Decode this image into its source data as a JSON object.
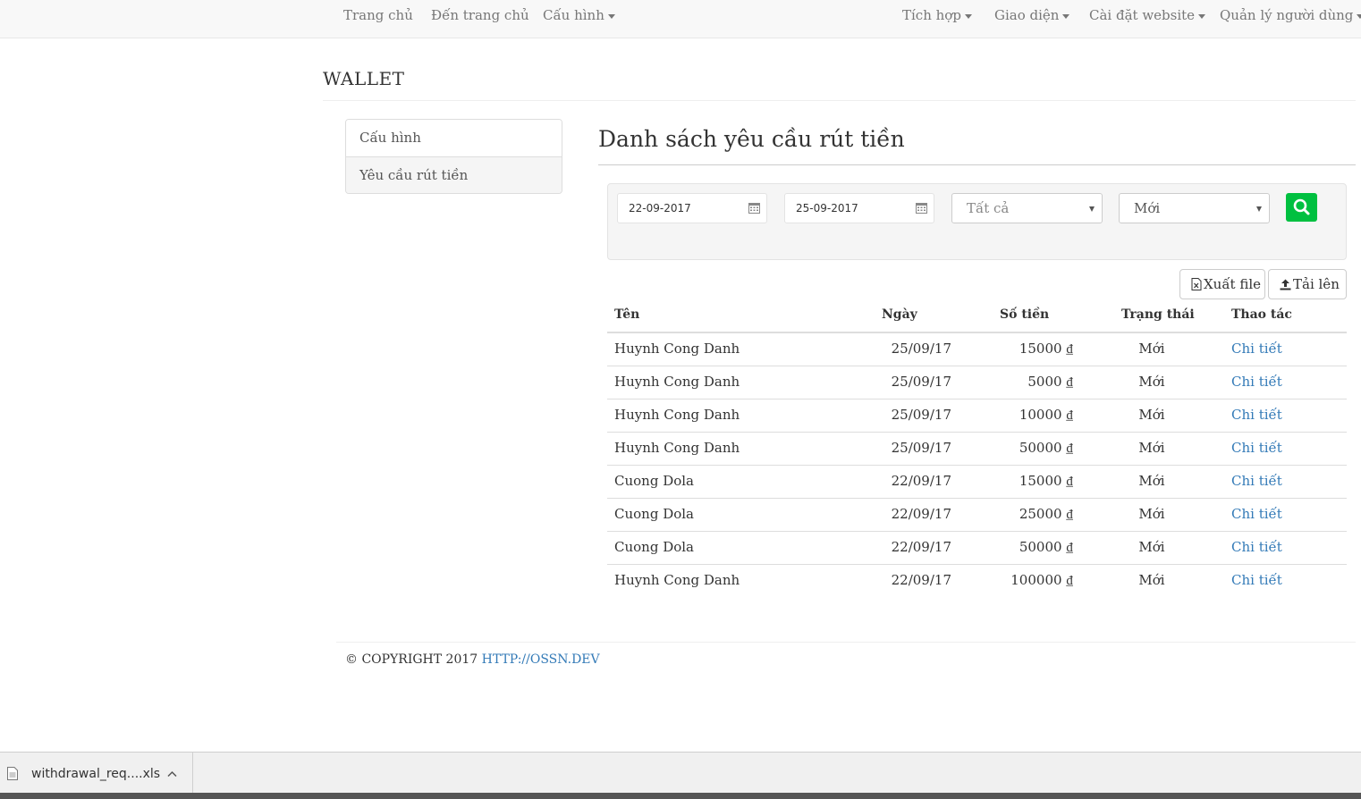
{
  "navbar": {
    "items": [
      {
        "label": "Trang chủ",
        "dropdown": false
      },
      {
        "label": "Đến trang chủ",
        "dropdown": false
      },
      {
        "label": "Cấu hình",
        "dropdown": true
      }
    ],
    "right_items": [
      {
        "label": "Tích hợp",
        "dropdown": true
      },
      {
        "label": "Giao diện",
        "dropdown": true
      },
      {
        "label": "Cài đặt website",
        "dropdown": true
      },
      {
        "label": "Quản lý người dùng",
        "dropdown": true
      }
    ]
  },
  "admin_title": "WALLET",
  "sidebar": {
    "items": [
      {
        "label": "Cấu hình",
        "active": false
      },
      {
        "label": "Yêu cầu rút tiền",
        "active": true
      }
    ]
  },
  "page_heading": "Danh sách yêu cầu rút tiền",
  "filters": {
    "from_date": "22-09-2017",
    "to_date": "25-09-2017",
    "type_select": "Tất cả",
    "status_select": "Mới",
    "search_icon": "search-icon",
    "calendar_icon": "calendar-icon"
  },
  "actions": {
    "export_label": "Xuất file",
    "upload_label": "Tải lên"
  },
  "table": {
    "headers": [
      "Tên",
      "Ngày",
      "Số tiền",
      "Trạng thái",
      "Thao tác"
    ],
    "rows": [
      {
        "name": "Huynh Cong Danh",
        "date": "25/09/17",
        "amount": "15000 ₫",
        "status": "Mới",
        "action": "Chi tiết"
      },
      {
        "name": "Huynh Cong Danh",
        "date": "25/09/17",
        "amount": "5000 ₫",
        "status": "Mới",
        "action": "Chi tiết"
      },
      {
        "name": "Huynh Cong Danh",
        "date": "25/09/17",
        "amount": "10000 ₫",
        "status": "Mới",
        "action": "Chi tiết"
      },
      {
        "name": "Huynh Cong Danh",
        "date": "25/09/17",
        "amount": "50000 ₫",
        "status": "Mới",
        "action": "Chi tiết"
      },
      {
        "name": "Cuong Dola",
        "date": "22/09/17",
        "amount": "15000 ₫",
        "status": "Mới",
        "action": "Chi tiết"
      },
      {
        "name": "Cuong Dola",
        "date": "22/09/17",
        "amount": "25000 ₫",
        "status": "Mới",
        "action": "Chi tiết"
      },
      {
        "name": "Cuong Dola",
        "date": "22/09/17",
        "amount": "50000 ₫",
        "status": "Mới",
        "action": "Chi tiết"
      },
      {
        "name": "Huynh Cong Danh",
        "date": "22/09/17",
        "amount": "100000 ₫",
        "status": "Mới",
        "action": "Chi tiết"
      }
    ]
  },
  "footer": {
    "copyright": "© COPYRIGHT 2017",
    "link": "HTTP://OSSN.DEV"
  },
  "download_bar": {
    "file_name": "withdrawal_req....xls"
  },
  "colors": {
    "link": "#337ab7",
    "search_button": "#00c040",
    "navbar_bg": "#f8f8f8"
  }
}
